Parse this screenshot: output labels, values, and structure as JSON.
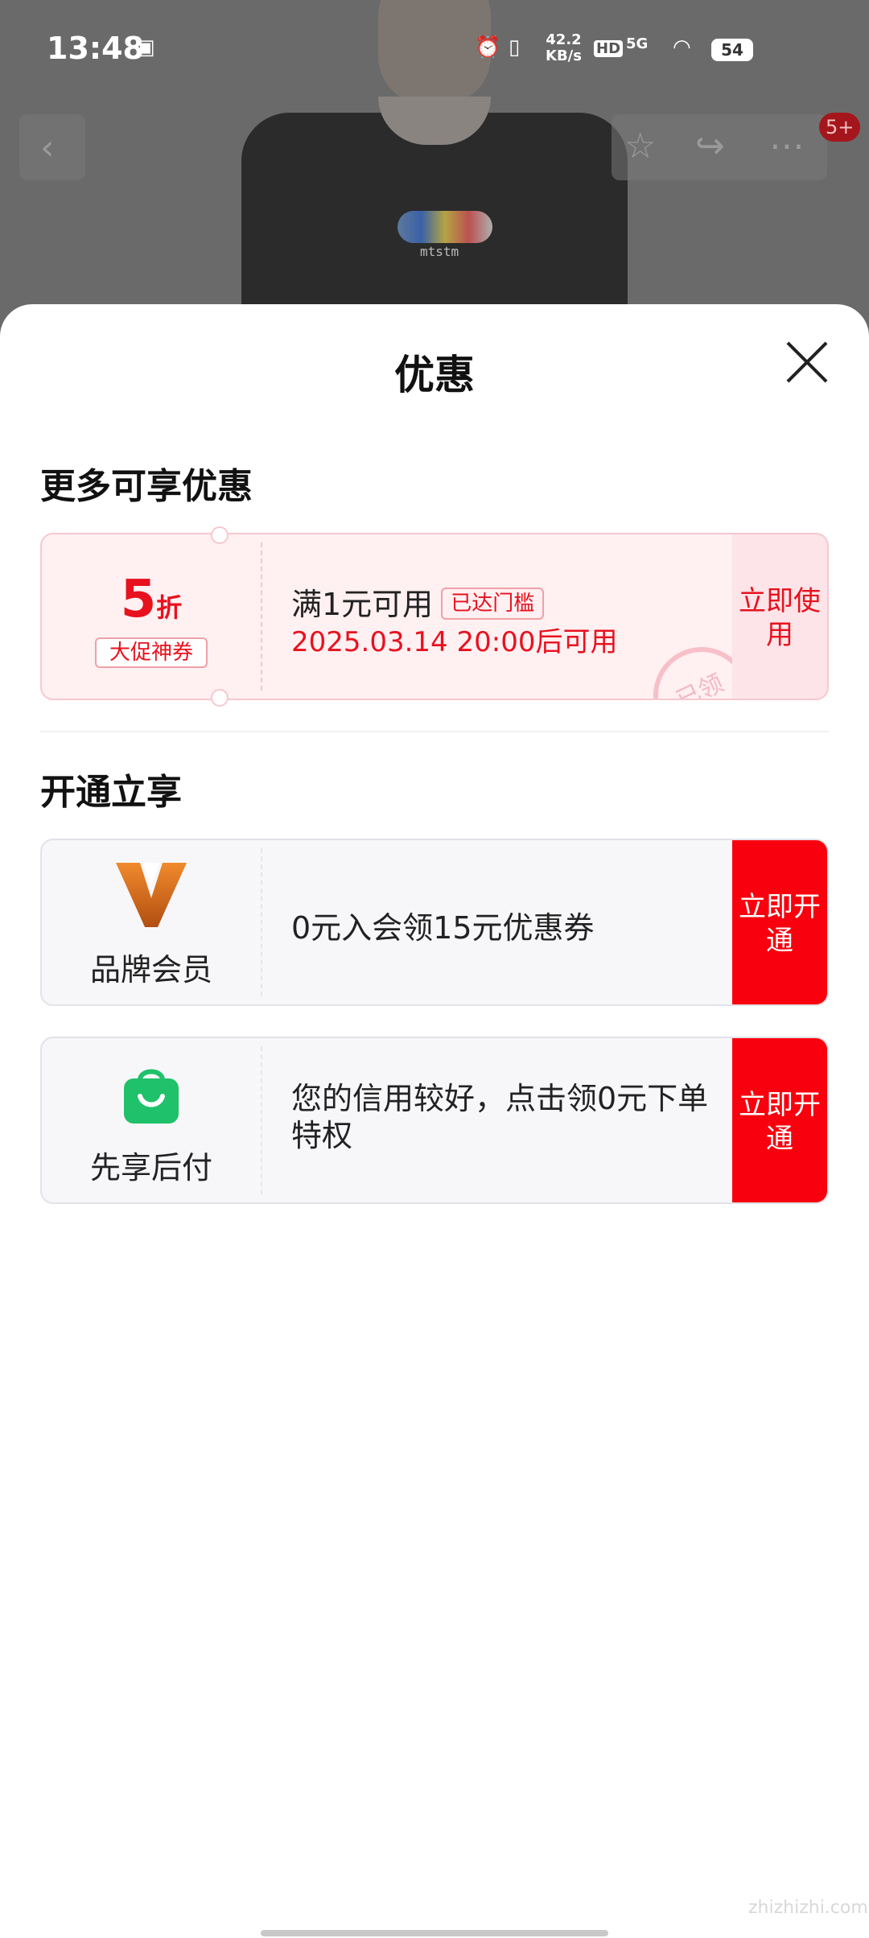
{
  "status_bar": {
    "time": "13:48",
    "net_speed": "42.2",
    "net_unit": "KB/s",
    "hd": "HD",
    "signal": "5G",
    "battery": "54"
  },
  "product_header": {
    "shirt_text": "mtstm",
    "badge": "5+"
  },
  "sheet": {
    "title": "优惠"
  },
  "section_more": {
    "title": "更多可享优惠",
    "coupon": {
      "discount_value": "5",
      "discount_unit": "折",
      "tag": "大促神券",
      "condition": "满1元可用",
      "threshold_chip": "已达门槛",
      "valid_time": "2025.03.14 20:00后可用",
      "stamp": "已领",
      "button": "立即使用"
    }
  },
  "section_open": {
    "title": "开通立享",
    "items": [
      {
        "label": "品牌会员",
        "description": "0元入会领15元优惠券",
        "button": "立即开通",
        "icon": "brand-v-icon",
        "icon_color": "#d86a1a"
      },
      {
        "label": "先享后付",
        "description": "您的信用较好，点击领0元下单特权",
        "button": "立即开通",
        "icon": "shopping-bag-icon",
        "icon_color": "#1fc16b"
      }
    ]
  },
  "watermark": "zhizhizhi.com",
  "colors": {
    "accent_red": "#e8111e",
    "button_red": "#f8000d",
    "coupon_bg": "#fff0f2"
  }
}
